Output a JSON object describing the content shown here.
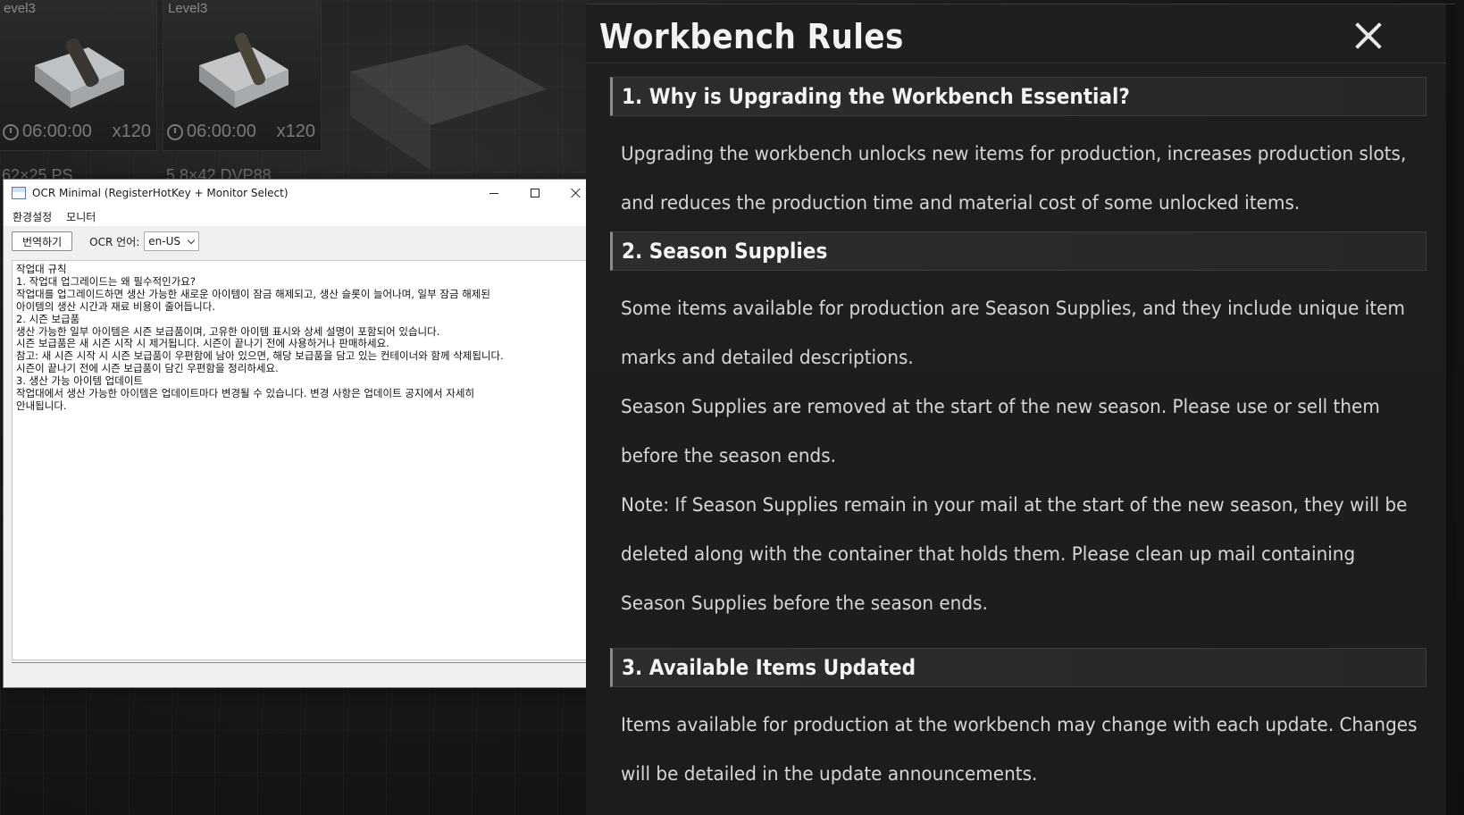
{
  "background": {
    "items": [
      {
        "level": "evel3",
        "time": "06:00:00",
        "qty": "x120",
        "name": "62×25 PS"
      },
      {
        "level": "Level3",
        "time": "06:00:00",
        "qty": "x120",
        "name": "5.8×42 DVP88"
      }
    ]
  },
  "ocr_window": {
    "title": "OCR Minimal (RegisterHotKey + Monitor Select)",
    "menu": [
      "환경설정",
      "모니터"
    ],
    "translate_button": "번역하기",
    "lang_label": "OCR 언어:",
    "lang_value": "en-US",
    "text_lines": [
      "작업대 규칙",
      "1. 작업대 업그레이드는 왜 필수적인가요?",
      "작업대를 업그레이드하면 생산 가능한 새로운 아이템이 잠금 해제되고, 생산 슬롯이 늘어나며, 일부 잠금 해제된",
      "아이템의 생산 시간과 재료 비용이 줄어듭니다.",
      "2. 시즌 보급품",
      "생산 가능한 일부 아이템은 시즌 보급품이며, 고유한 아이템 표시와 상세 설명이 포함되어 있습니다.",
      "시즌 보급품은 새 시즌 시작 시 제거됩니다. 시즌이 끝나기 전에 사용하거나 판매하세요.",
      "참고: 새 시즌 시작 시 시즌 보급품이 우편함에 남아 있으면, 해당 보급품을 담고 있는 컨테이너와 함께 삭제됩니다.",
      "시즌이 끝나기 전에 시즌 보급품이 담긴 우편함을 정리하세요.",
      "3. 생산 가능 아이템 업데이트",
      "작업대에서 생산 가능한 아이템은 업데이트마다 변경될 수 있습니다. 변경 사항은 업데이트 공지에서 자세히",
      "안내됩니다."
    ]
  },
  "rules_panel": {
    "title": "Workbench Rules",
    "sections": [
      {
        "heading": "1. Why is Upgrading the Workbench Essential?",
        "lines": [
          "Upgrading the workbench unlocks new items for production, increases production slots,",
          "and reduces the production time and material cost of some unlocked items."
        ]
      },
      {
        "heading": "2. Season Supplies",
        "lines": [
          "Some items available for production are Season Supplies, and they include unique item",
          "marks and detailed descriptions.",
          "Season Supplies are removed at the start of the new season. Please use or sell them",
          "before the season ends.",
          "Note: If Season Supplies remain in your mail at the start of the new season, they will be",
          "deleted along with the container that holds them. Please clean up mail containing",
          "Season Supplies before the season ends."
        ]
      },
      {
        "heading": "3. Available Items Updated",
        "lines": [
          "Items available for production at the workbench may change with each update. Changes",
          "will be detailed in the update announcements."
        ]
      }
    ]
  }
}
